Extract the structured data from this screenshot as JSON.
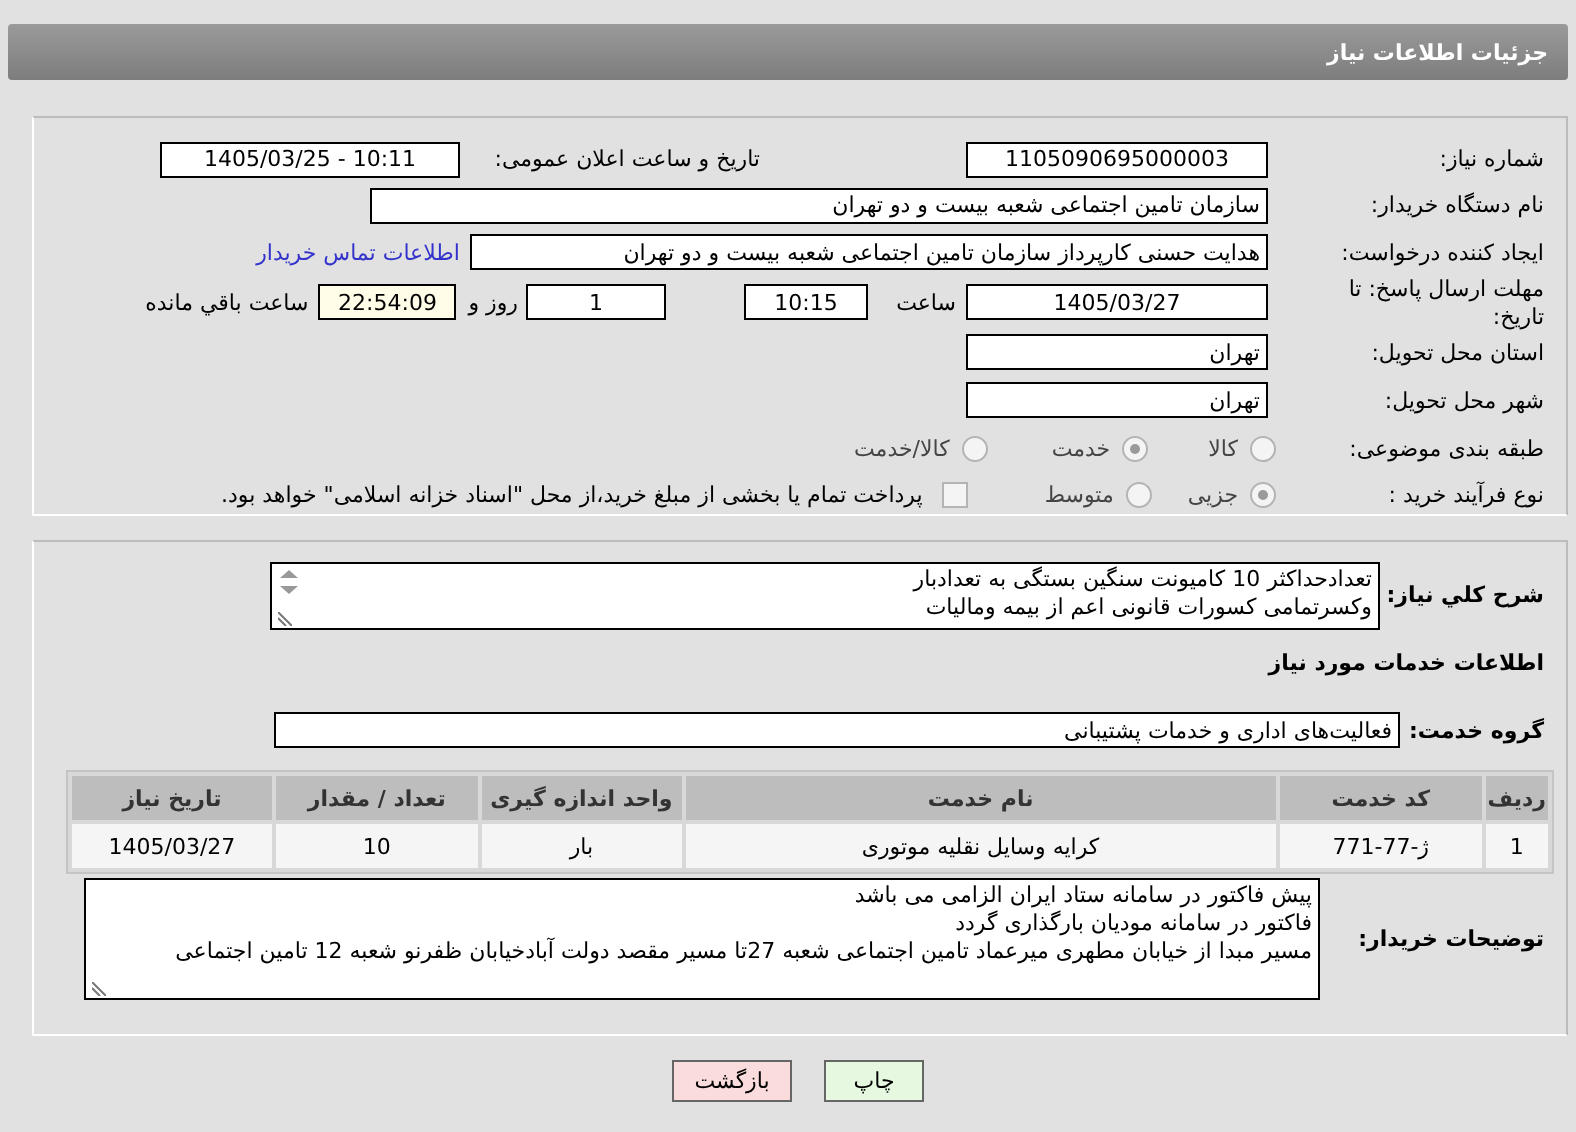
{
  "header": {
    "title": "جزئیات اطلاعات نیاز"
  },
  "need_number": {
    "label": "شماره نیاز:",
    "value": "1105090695000003"
  },
  "announce": {
    "label": "تاریخ و ساعت اعلان عمومی:",
    "value": "1405/03/25 - 10:11"
  },
  "buyer": {
    "label": "نام دستگاه خریدار:",
    "value": "سازمان تامین اجتماعی شعبه بیست و دو تهران"
  },
  "requester": {
    "label": "ایجاد کننده درخواست:",
    "value": "هدایت حسنی کارپرداز سازمان تامین اجتماعی شعبه بیست و دو تهران",
    "link": "اطلاعات تماس خریدار"
  },
  "deadline": {
    "label": "مهلت ارسال پاسخ: تا تاریخ:",
    "date": "1405/03/27",
    "time_label": "ساعت",
    "time": "10:15",
    "days": "1",
    "days_label": "روز و",
    "remaining": "22:54:09",
    "remaining_label": "ساعت باقي مانده"
  },
  "province": {
    "label": "استان محل تحویل:",
    "value": "تهران"
  },
  "city": {
    "label": "شهر محل تحویل:",
    "value": "تهران"
  },
  "category": {
    "label": "طبقه بندی موضوعی:",
    "options": [
      {
        "label": "کالا",
        "selected": false
      },
      {
        "label": "خدمت",
        "selected": true
      },
      {
        "label": "کالا/خدمت",
        "selected": false
      }
    ]
  },
  "process": {
    "label": "نوع فرآیند خرید :",
    "options": [
      {
        "label": "جزیی",
        "selected": true
      },
      {
        "label": "متوسط",
        "selected": false
      }
    ],
    "treasury": {
      "label": "پرداخت تمام یا بخشی از مبلغ خرید،از محل \"اسناد خزانه اسلامی\" خواهد بود.",
      "checked": false
    }
  },
  "description": {
    "label": "شرح کلي نیاز:",
    "lines": [
      "تعدادحداکثر 10 کامیونت سنگین بستگی به تعدادبار",
      "وکسرتمامی کسورات قانونی اعم از بیمه ومالیات"
    ]
  },
  "services_title": "اطلاعات خدمات مورد نیاز",
  "service_group": {
    "label": "گروه خدمت:",
    "value": "فعالیت‌های اداری و خدمات پشتیبانی"
  },
  "table": {
    "columns": [
      "ردیف",
      "کد خدمت",
      "نام خدمت",
      "واحد اندازه گیری",
      "تعداد / مقدار",
      "تاریخ نیاز"
    ],
    "rows": [
      [
        "1",
        "ژ-77-771",
        "کرایه وسایل نقلیه موتوری",
        "بار",
        "10",
        "1405/03/27"
      ]
    ]
  },
  "buyer_notes": {
    "label": "توضیحات خریدار:",
    "lines": [
      "پیش فاکتور در سامانه ستاد ایران الزامی می باشد",
      "فاکتور در سامانه مودیان بارگذاری گردد",
      "مسیر مبدا از  خیابان مطهری میرعماد تامین اجتماعی شعبه 27تا مسیر مقصد دولت آبادخیابان ظفرنو شعبه 12 تامین اجتماعی"
    ]
  },
  "buttons": [
    {
      "label": "چاپ",
      "kind": "print"
    },
    {
      "label": "بازگشت",
      "kind": "back"
    }
  ]
}
